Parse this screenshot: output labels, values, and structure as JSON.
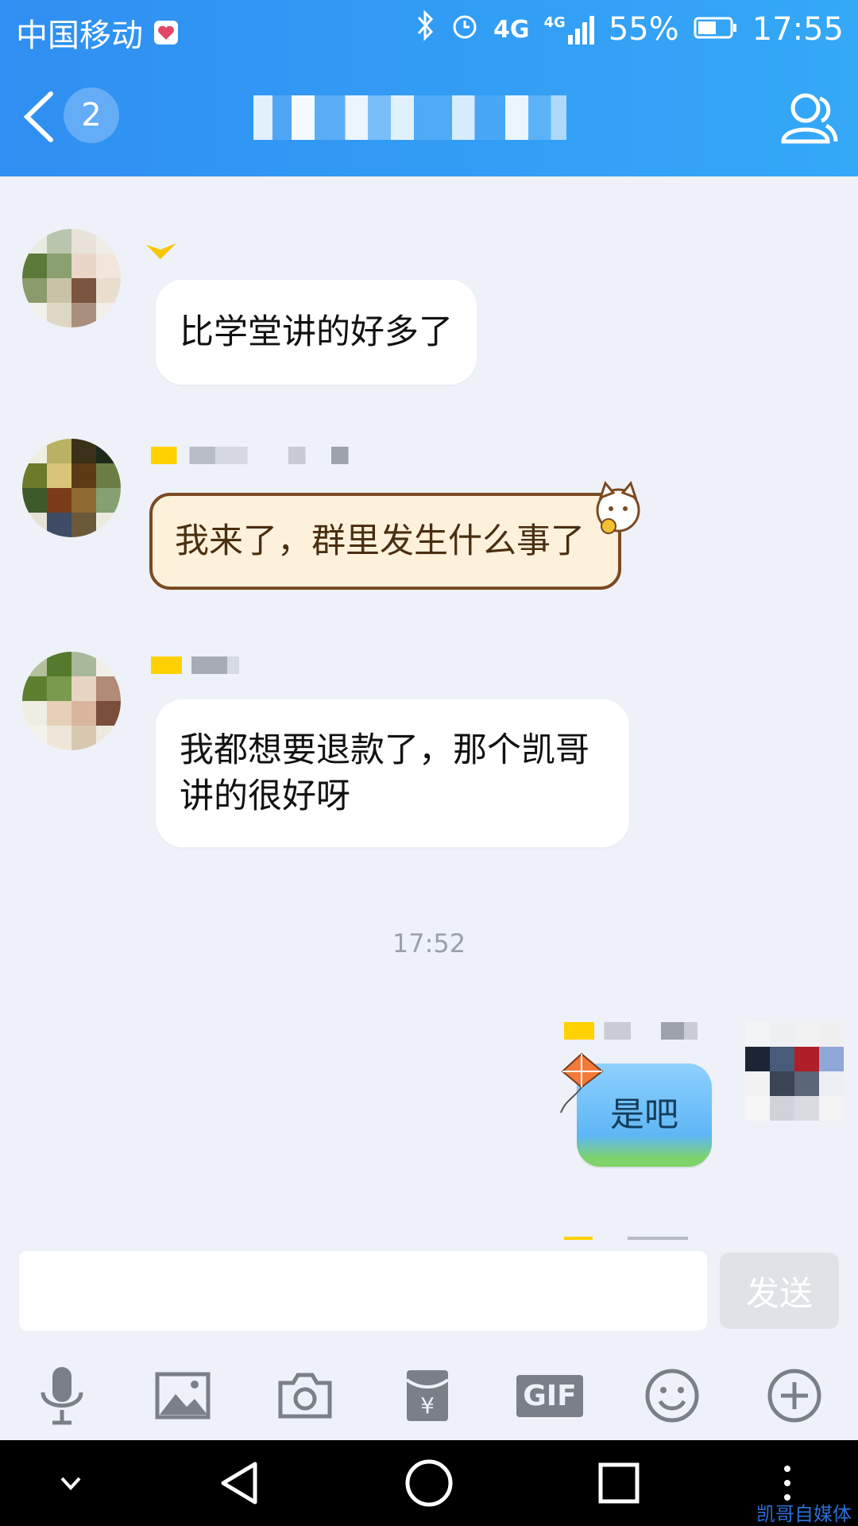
{
  "status_bar": {
    "carrier": "中国移动",
    "network_1": "4G",
    "network_2": "4G",
    "battery": "55%",
    "time": "17:55"
  },
  "header": {
    "unread_count": "2"
  },
  "messages": [
    {
      "text": "比学堂讲的好多了"
    },
    {
      "text": "我来了，群里发生什么事了"
    },
    {
      "text": "我都想要退款了，那个凯哥讲的很好呀"
    },
    {
      "text": "是吧"
    }
  ],
  "timestamp": "17:52",
  "composer": {
    "send_label": "发送",
    "input_value": ""
  },
  "toolbar": {
    "gif_label": "GIF",
    "tools": [
      "microphone-icon",
      "image-icon",
      "camera-icon",
      "red-packet-icon",
      "gif-icon",
      "emoji-icon",
      "plus-icon"
    ]
  },
  "watermark": "凯哥自媒体",
  "colors": {
    "header": "#2f8ff2",
    "background": "#eef1f7",
    "bubble": "#ffffff",
    "cat_bubble": "#fdf1dc",
    "kite_bubble": "#5eb6f5",
    "nav_bar": "#000000"
  }
}
